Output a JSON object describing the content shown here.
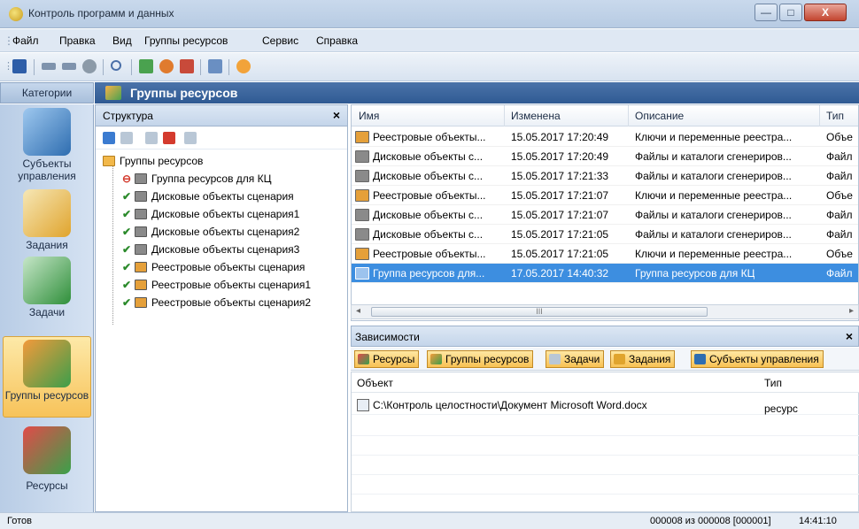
{
  "window": {
    "title": "Контроль программ и данных",
    "min": "—",
    "max": "□",
    "close": "X"
  },
  "menu": [
    "Файл",
    "Правка",
    "Вид",
    "Группы ресурсов",
    "Сервис",
    "Справка"
  ],
  "categories": {
    "header": "Категории",
    "items": [
      {
        "label": "Субъекты управления",
        "icon": "users-monitor-icon"
      },
      {
        "label": "Задания",
        "icon": "clipboard-clock-icon"
      },
      {
        "label": "Задачи",
        "icon": "typewriter-icon"
      },
      {
        "label": "Группы ресурсов",
        "icon": "resource-group-icon"
      },
      {
        "label": "Ресурсы",
        "icon": "cubes-icon"
      }
    ]
  },
  "main_header": "Группы ресурсов",
  "structure": {
    "title": "Структура",
    "close": "×",
    "root": "Группы ресурсов",
    "children": [
      {
        "label": "Группа ресурсов для КЦ",
        "mark": "⊖"
      },
      {
        "label": "Дисковые объекты сценария",
        "mark": "✔"
      },
      {
        "label": "Дисковые объекты сценария1",
        "mark": "✔"
      },
      {
        "label": "Дисковые объекты сценария2",
        "mark": "✔"
      },
      {
        "label": "Дисковые объекты сценария3",
        "mark": "✔"
      },
      {
        "label": "Реестровые объекты сценария",
        "mark": "✔"
      },
      {
        "label": "Реестровые объекты сценария1",
        "mark": "✔"
      },
      {
        "label": "Реестровые объекты сценария2",
        "mark": "✔"
      }
    ]
  },
  "grid": {
    "columns": [
      "Имя",
      "Изменена",
      "Описание",
      "Тип"
    ],
    "rows": [
      [
        "Реестровые объекты...",
        "15.05.2017 17:20:49",
        "Ключи и переменные реестра...",
        "Объе"
      ],
      [
        "Дисковые объекты с...",
        "15.05.2017 17:20:49",
        "Файлы и каталоги сгенериров...",
        "Файл"
      ],
      [
        "Дисковые объекты с...",
        "15.05.2017 17:21:33",
        "Файлы и каталоги сгенериров...",
        "Файл"
      ],
      [
        "Реестровые объекты...",
        "15.05.2017 17:21:07",
        "Ключи и переменные реестра...",
        "Объе"
      ],
      [
        "Дисковые объекты с...",
        "15.05.2017 17:21:07",
        "Файлы и каталоги сгенериров...",
        "Файл"
      ],
      [
        "Дисковые объекты с...",
        "15.05.2017 17:21:05",
        "Файлы и каталоги сгенериров...",
        "Файл"
      ],
      [
        "Реестровые объекты...",
        "15.05.2017 17:21:05",
        "Ключи и переменные реестра...",
        "Объе"
      ],
      [
        "Группа ресурсов для...",
        "17.05.2017 14:40:32",
        "Группа ресурсов для КЦ",
        "Файл"
      ]
    ],
    "scroll_thumb": "III"
  },
  "dependencies": {
    "title": "Зависимости",
    "close": "×",
    "tabs": [
      "Ресурсы",
      "Группы ресурсов",
      "Задачи",
      "Задания",
      "Субъекты управления"
    ],
    "columns": [
      "Объект",
      "Тип"
    ],
    "rows": [
      [
        "C:\\Контроль целостности\\Документ Microsoft Word.docx",
        "ресурс"
      ]
    ]
  },
  "status": {
    "left": "Готов",
    "counter": "000008 из 000008 [000001]",
    "time": "14:41:10"
  }
}
